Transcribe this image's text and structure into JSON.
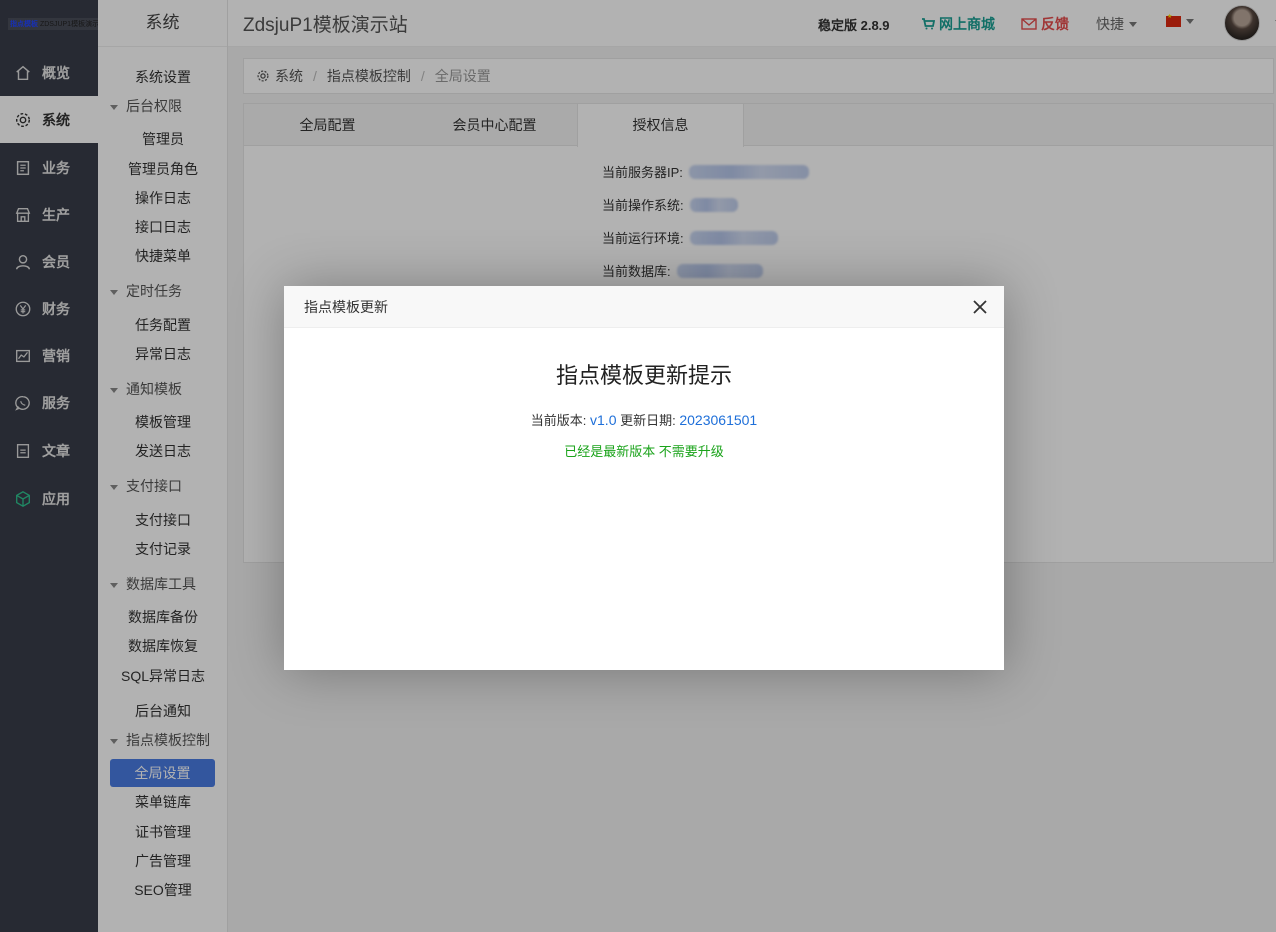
{
  "rail": {
    "logo_text_a": "指点模板",
    "logo_text_b": "ZDSJUP1模板演示",
    "items": [
      {
        "label": "概览",
        "icon": "home-icon"
      },
      {
        "label": "系统",
        "icon": "gear-icon"
      },
      {
        "label": "业务",
        "icon": "book-icon"
      },
      {
        "label": "生产",
        "icon": "store-icon"
      },
      {
        "label": "会员",
        "icon": "user-icon"
      },
      {
        "label": "财务",
        "icon": "yen-icon"
      },
      {
        "label": "营销",
        "icon": "chart-icon"
      },
      {
        "label": "服务",
        "icon": "chat-icon"
      },
      {
        "label": "文章",
        "icon": "document-icon"
      },
      {
        "label": "应用",
        "icon": "cube-icon"
      }
    ]
  },
  "submenu": {
    "title": "系统",
    "system_settings": "系统设置",
    "group_admin": "后台权限",
    "admin": "管理员",
    "admin_role": "管理员角色",
    "op_log": "操作日志",
    "api_log": "接口日志",
    "quick_menu": "快捷菜单",
    "group_cron": "定时任务",
    "task_config": "任务配置",
    "error_log": "异常日志",
    "group_notify": "通知模板",
    "template_manage": "模板管理",
    "send_log": "发送日志",
    "group_pay": "支付接口",
    "pay_api": "支付接口",
    "pay_record": "支付记录",
    "group_db": "数据库工具",
    "db_backup": "数据库备份",
    "db_restore": "数据库恢复",
    "sql_log": "SQL异常日志",
    "admin_notice": "后台通知",
    "group_template": "指点模板控制",
    "global_settings": "全局设置",
    "menu_chain": "菜单链库",
    "cert_manage": "证书管理",
    "ad_manage": "广告管理",
    "seo_manage": "SEO管理"
  },
  "header": {
    "site_title": "ZdsjuP1模板演示站",
    "version": "稳定版 2.8.9",
    "shop": "网上商城",
    "feedback": "反馈",
    "quick": "快捷"
  },
  "breadcrumb": {
    "root": "系统",
    "mid": "指点模板控制",
    "current": "全局设置"
  },
  "tabs": {
    "global_config": "全局配置",
    "member_config": "会员中心配置",
    "license_info": "授权信息"
  },
  "info": {
    "server_ip": "当前服务器IP:",
    "os": "当前操作系统:",
    "runtime": "当前运行环境:",
    "database": "当前数据库:"
  },
  "modal": {
    "head": "指点模板更新",
    "title": "指点模板更新提示",
    "version_label": "当前版本:",
    "version": "v1.0",
    "date_label": "更新日期:",
    "date": "2023061501",
    "status": "已经是最新版本 不需要升级"
  },
  "colors": {
    "rail_bg": "#393d49",
    "accent": "#4a7be3",
    "shop": "#1aa094",
    "feedback": "#e64c4c",
    "ok": "#1aa31a"
  }
}
